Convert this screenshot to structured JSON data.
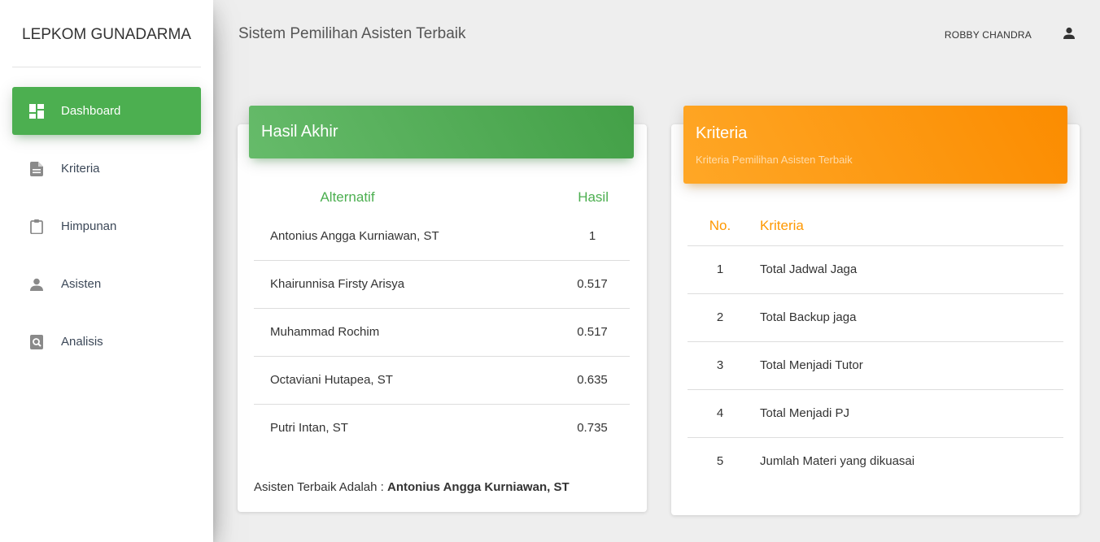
{
  "brand": "LEPKOM GUNADARMA",
  "sidebar": {
    "items": [
      {
        "label": "Dashboard",
        "icon": "dashboard-icon",
        "active": true
      },
      {
        "label": "Kriteria",
        "icon": "document-icon",
        "active": false
      },
      {
        "label": "Himpunan",
        "icon": "clipboard-icon",
        "active": false
      },
      {
        "label": "Asisten",
        "icon": "person-icon",
        "active": false
      },
      {
        "label": "Analisis",
        "icon": "search-document-icon",
        "active": false
      }
    ]
  },
  "header": {
    "title": "Sistem Pemilihan Asisten Terbaik",
    "user_name": "ROBBY CHANDRA",
    "user_icon": "person-icon"
  },
  "hasil_card": {
    "title": "Hasil Akhir",
    "columns": [
      "Alternatif",
      "Hasil"
    ],
    "rows": [
      {
        "name": "Antonius Angga Kurniawan, ST",
        "value": "1"
      },
      {
        "name": "Khairunnisa Firsty Arisya",
        "value": "0.517"
      },
      {
        "name": "Muhammad Rochim",
        "value": "0.517"
      },
      {
        "name": "Octaviani Hutapea, ST",
        "value": "0.635"
      },
      {
        "name": "Putri Intan, ST",
        "value": "0.735"
      }
    ],
    "summary_label": "Asisten Terbaik Adalah : ",
    "summary_value": "Antonius Angga Kurniawan, ST"
  },
  "kriteria_card": {
    "title": "Kriteria",
    "subtitle": "Kriteria Pemilihan Asisten Terbaik",
    "columns": [
      "No.",
      "Kriteria"
    ],
    "rows": [
      {
        "no": "1",
        "name": "Total Jadwal Jaga"
      },
      {
        "no": "2",
        "name": "Total Backup jaga"
      },
      {
        "no": "3",
        "name": "Total Menjadi Tutor"
      },
      {
        "no": "4",
        "name": "Total Menjadi PJ"
      },
      {
        "no": "5",
        "name": "Jumlah Materi yang dikuasai"
      }
    ]
  },
  "colors": {
    "green": "#4caf50",
    "orange": "#ff9800",
    "background": "#eeeeee"
  }
}
